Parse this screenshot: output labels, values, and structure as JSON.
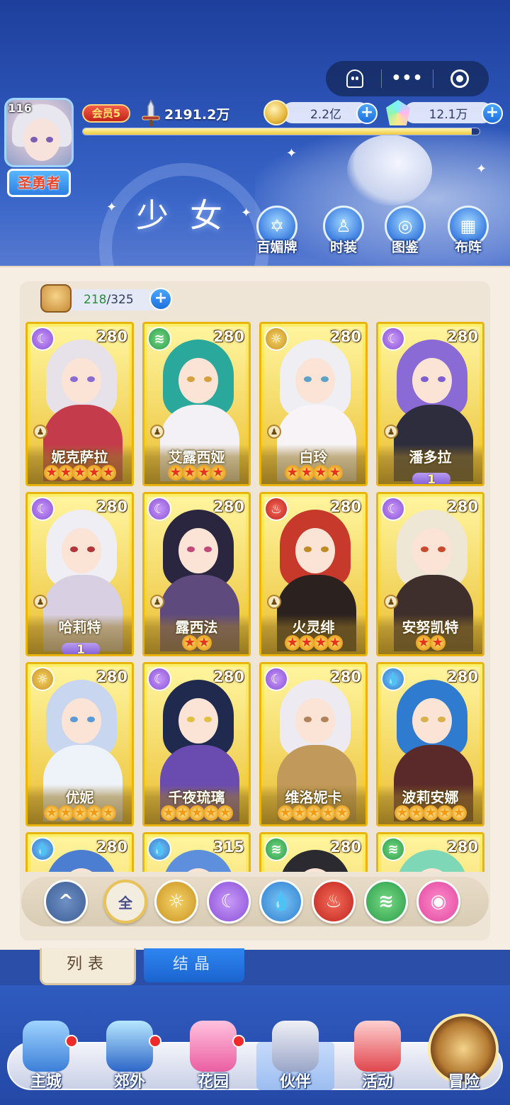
{
  "header": {
    "level": "116",
    "title": "圣勇者",
    "vip": "会员5",
    "power": "2191.2万",
    "gold": "2.2亿",
    "gems": "12.1万",
    "exp_fraction": 0.98,
    "page_title": "少女",
    "buttons": [
      {
        "label": "百媚牌",
        "icon": "card-icon"
      },
      {
        "label": "时装",
        "icon": "outfit-icon"
      },
      {
        "label": "图鉴",
        "icon": "book-icon"
      },
      {
        "label": "布阵",
        "icon": "grid-icon"
      }
    ],
    "capsule": [
      "ghost-icon",
      "more-icon",
      "target-icon"
    ]
  },
  "roster": {
    "owned": "218",
    "max": "325",
    "sep": "/",
    "cards": [
      {
        "name": "妮克萨拉",
        "level": "280",
        "element": "moon",
        "stars": 5,
        "star_color": "red",
        "advance": ""
      },
      {
        "name": "艾露西娅",
        "level": "280",
        "element": "wind",
        "stars": 4,
        "star_color": "red",
        "advance": ""
      },
      {
        "name": "白玲",
        "level": "280",
        "element": "sun",
        "stars": 4,
        "star_color": "red",
        "advance": ""
      },
      {
        "name": "潘多拉",
        "level": "280",
        "element": "moon",
        "stars": 0,
        "star_color": "red",
        "advance": "1"
      },
      {
        "name": "哈莉特",
        "level": "280",
        "element": "moon",
        "stars": 0,
        "star_color": "red",
        "advance": "1"
      },
      {
        "name": "露西法",
        "level": "280",
        "element": "moon",
        "stars": 2,
        "star_color": "red",
        "advance": ""
      },
      {
        "name": "火灵绯",
        "level": "280",
        "element": "fire",
        "stars": 4,
        "star_color": "red",
        "advance": ""
      },
      {
        "name": "安努凯特",
        "level": "280",
        "element": "moon",
        "stars": 2,
        "star_color": "red",
        "advance": ""
      },
      {
        "name": "优妮",
        "level": "280",
        "element": "sun",
        "stars": 5,
        "star_color": "gold",
        "advance": ""
      },
      {
        "name": "千夜琉璃",
        "level": "280",
        "element": "moon",
        "stars": 5,
        "star_color": "gold",
        "advance": ""
      },
      {
        "name": "维洛妮卡",
        "level": "280",
        "element": "moon",
        "stars": 5,
        "star_color": "gold",
        "advance": ""
      },
      {
        "name": "波莉安娜",
        "level": "280",
        "element": "water",
        "stars": 5,
        "star_color": "gold",
        "advance": ""
      },
      {
        "name": "",
        "level": "280",
        "element": "water",
        "stars": 0,
        "star_color": "gold",
        "advance": ""
      },
      {
        "name": "",
        "level": "315",
        "element": "water",
        "stars": 0,
        "star_color": "gold",
        "advance": ""
      },
      {
        "name": "",
        "level": "280",
        "element": "wind",
        "stars": 0,
        "star_color": "gold",
        "advance": ""
      },
      {
        "name": "",
        "level": "280",
        "element": "wind",
        "stars": 0,
        "star_color": "gold",
        "advance": ""
      }
    ]
  },
  "filters": [
    {
      "key": "collapse",
      "label": "^"
    },
    {
      "key": "all",
      "label": "全"
    },
    {
      "key": "sun",
      "label": "☼"
    },
    {
      "key": "moon",
      "label": "☾"
    },
    {
      "key": "water",
      "label": "💧"
    },
    {
      "key": "fire",
      "label": "♨"
    },
    {
      "key": "wind",
      "label": "≋"
    },
    {
      "key": "pink",
      "label": "◉"
    }
  ],
  "tabs": {
    "list": "列表",
    "crystal": "结晶"
  },
  "nav": [
    {
      "label": "主城",
      "badge": true,
      "icon": "castle-icon"
    },
    {
      "label": "郊外",
      "badge": true,
      "icon": "portal-icon"
    },
    {
      "label": "花园",
      "badge": true,
      "icon": "heart-icon"
    },
    {
      "label": "伙伴",
      "badge": false,
      "icon": "partner-icon",
      "active": true
    },
    {
      "label": "活动",
      "badge": false,
      "icon": "gift-icon"
    },
    {
      "label": "冒险",
      "badge": false,
      "icon": "compass-icon"
    }
  ],
  "colors": {
    "moon": "#8a4fd8",
    "wind": "#2a9c4a",
    "sun": "#c8931e",
    "fire": "#c0241d",
    "water": "#2d7fd0",
    "pink": "#e0479e",
    "card_gold": "#f2c21f"
  }
}
